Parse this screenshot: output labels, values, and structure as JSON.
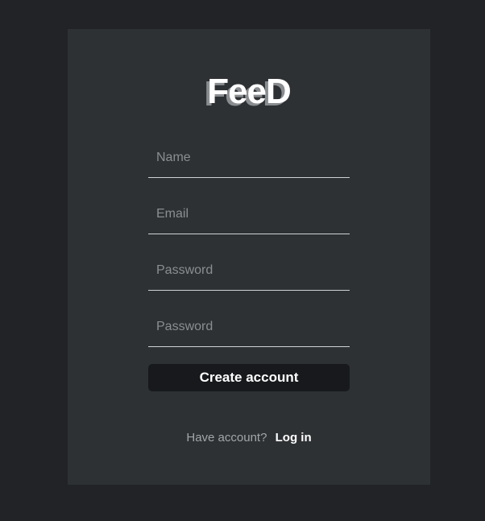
{
  "brand": {
    "logo_text": "FeeD"
  },
  "form": {
    "name_placeholder": "Name",
    "email_placeholder": "Email",
    "password_placeholder": "Password",
    "confirm_password_placeholder": "Password",
    "submit_label": "Create account"
  },
  "footer": {
    "question": "Have account?",
    "login_link": "Log in"
  },
  "colors": {
    "page_background": "#222326",
    "card_background": "#2e3134",
    "button_background": "#17191c",
    "text_primary": "#ffffff",
    "text_muted": "#8b8e91"
  }
}
